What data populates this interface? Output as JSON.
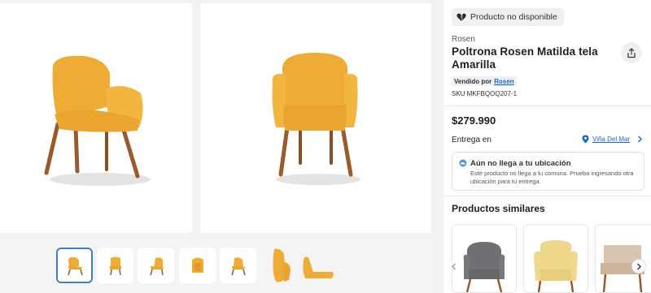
{
  "badge": {
    "text": "Producto no disponible",
    "icon": "broken-heart-icon"
  },
  "product": {
    "brand": "Rosen",
    "title": "Poltrona Rosen Matilda tela Amarilla",
    "seller_prefix": "Vendido por",
    "seller_name": "Rosen",
    "sku": "SKU MKFBQOQ207-1",
    "price": "$279.990"
  },
  "delivery": {
    "label": "Entrega en",
    "location": "Viña Del Mar"
  },
  "alert": {
    "title": "Aún no llega a tu ubicación",
    "body": "Este producto no llega a tu comuna. Prueba ingresando otra ubicación para tu entrega."
  },
  "similar": {
    "title": "Productos similares"
  },
  "colors": {
    "accent": "#1a66c8",
    "chair_yellow": "#f0b13b",
    "wood": "#9b5a2c",
    "thumb_border": "#3b82c4"
  }
}
